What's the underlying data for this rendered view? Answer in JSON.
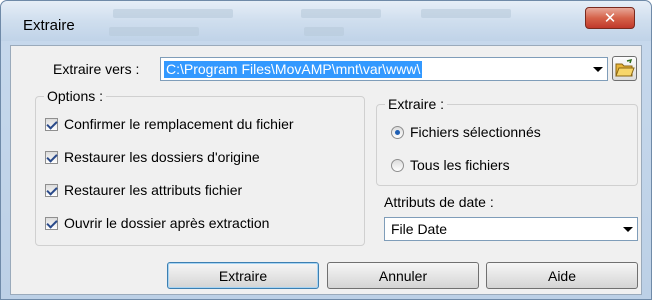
{
  "window": {
    "title": "Extraire",
    "close_glyph": "✕"
  },
  "destination": {
    "label": "Extraire vers :",
    "path": "C:\\Program Files\\MovAMP\\mnt\\var\\www\\",
    "folder_icon": "open-folder-icon"
  },
  "options": {
    "legend": "Options :",
    "items": [
      {
        "label": "Confirmer le remplacement du fichier",
        "checked": true
      },
      {
        "label": "Restaurer les dossiers d'origine",
        "checked": true
      },
      {
        "label": "Restaurer les attributs fichier",
        "checked": true
      },
      {
        "label": "Ouvrir le dossier après extraction",
        "checked": true
      }
    ]
  },
  "extract": {
    "legend": "Extraire :",
    "choices": [
      {
        "label": "Fichiers sélectionnés",
        "selected": true
      },
      {
        "label": "Tous les fichiers",
        "selected": false
      }
    ]
  },
  "date_attributes": {
    "label": "Attributs de date :",
    "value": "File Date"
  },
  "buttons": {
    "extract": "Extraire",
    "cancel": "Annuler",
    "help": "Aide"
  },
  "colors": {
    "selection": "#3399ff",
    "close_button": "#c0392b"
  }
}
